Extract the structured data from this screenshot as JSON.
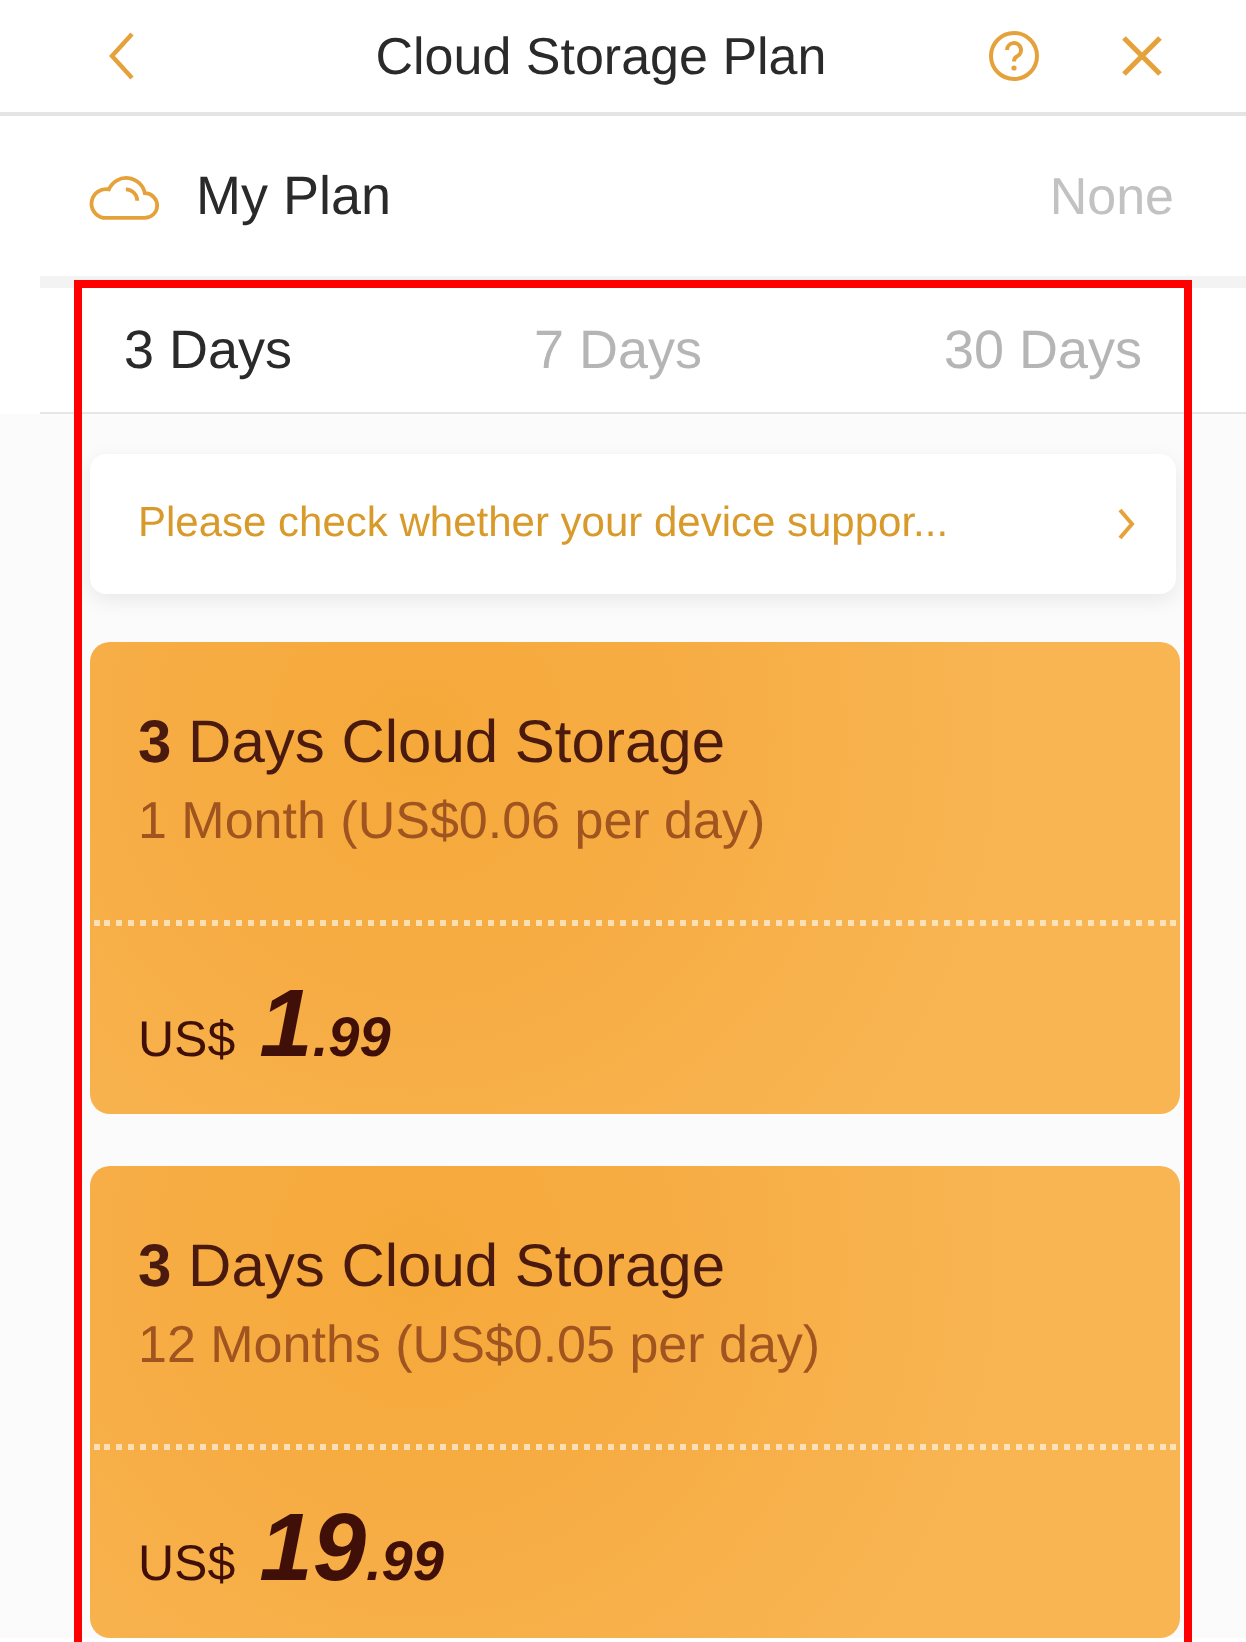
{
  "header": {
    "title": "Cloud Storage Plan"
  },
  "my_plan": {
    "label": "My Plan",
    "value": "None"
  },
  "tabs": [
    {
      "label": "3 Days",
      "selected": true
    },
    {
      "label": "7 Days",
      "selected": false
    },
    {
      "label": "30 Days",
      "selected": false
    }
  ],
  "notice": {
    "text": "Please check whether your device suppor..."
  },
  "plans": [
    {
      "title": "**3** Days Cloud Storage",
      "subtitle": "1 Month (US$0.06 per day)",
      "currency": "US$",
      "price_whole": "1",
      "price_fraction": ".99"
    },
    {
      "title": "**3** Days Cloud Storage",
      "subtitle": "12 Months (US$0.05 per day)",
      "currency": "US$",
      "price_whole": "19",
      "price_fraction": ".99"
    }
  ]
}
